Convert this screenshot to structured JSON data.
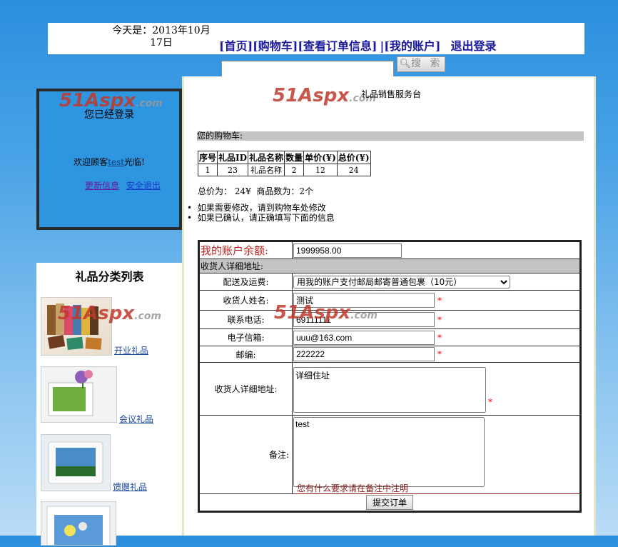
{
  "header": {
    "date_text": "今天是：2013年10月17日",
    "nav": [
      "[首页]",
      "[购物车]",
      "[查看订单信息]",
      "[我的账户]",
      "退出登录"
    ]
  },
  "search": {
    "button_label": "搜 索",
    "query": ""
  },
  "watermark": {
    "text": "51Aspx",
    "suffix": ".com"
  },
  "login_box": {
    "title": "您已经登录",
    "welcome_prefix": "欢迎顾客",
    "username": "test",
    "welcome_suffix": "光临!",
    "update_link": "更新信息",
    "logout_link": "安全退出"
  },
  "categories": {
    "title": "礼品分类列表",
    "items": [
      {
        "label": "开业礼品",
        "icon": "notebooks-photo"
      },
      {
        "label": "会议礼品",
        "icon": "photo-frame"
      },
      {
        "label": "馈赠礼品",
        "icon": "photo-frame-white"
      },
      {
        "label": "",
        "icon": "photo-frame-flowers"
      }
    ]
  },
  "main": {
    "service_title": "礼品销售服务台",
    "cart_header": "您的购物车:",
    "cart_columns": [
      "序号",
      "礼品ID",
      "礼品名称",
      "数量",
      "单价(¥)",
      "总价(¥)"
    ],
    "cart_rows": [
      [
        "1",
        "23",
        "礼品名称",
        "2",
        "12",
        "24"
      ]
    ],
    "total_label": "总价为：",
    "total_value": "24¥",
    "count_label": "商品数为：",
    "count_value": "2个",
    "notes": [
      "如果需要修改，请到购物车处修改",
      "如果已确认，请正确填写下面的信息"
    ]
  },
  "order_form": {
    "balance_label": "我的账户余额:",
    "balance_value": "1999958.00",
    "address_section": "收货人详细地址:",
    "shipping_label": "配送及运费:",
    "shipping_value": "用我的账户支付邮局邮寄普通包裹（10元）",
    "name_label": "收货人姓名:",
    "name_value": "测试",
    "phone_label": "联系电话:",
    "phone_value": "69111111",
    "email_label": "电子信箱:",
    "email_value": "uuu@163.com",
    "zip_label": "邮编:",
    "zip_value": "222222",
    "address_label": "收货人详细地址:",
    "address_value": "详细住址",
    "remark_label": "备注:",
    "remark_value": "test",
    "remark_hint": "您有什么要求请在备注中注明",
    "required_mark": "*",
    "submit_label": "提交订单"
  }
}
